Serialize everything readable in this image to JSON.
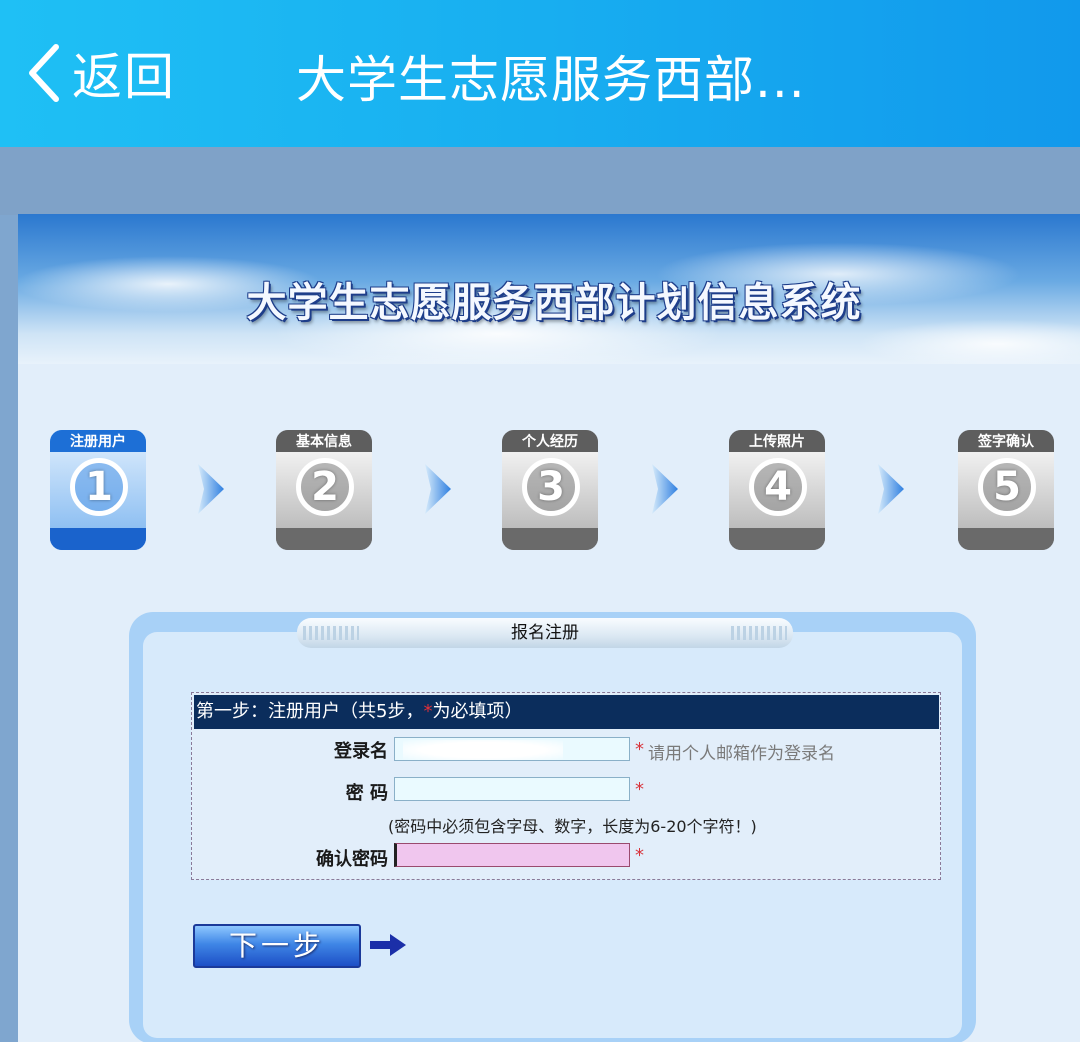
{
  "appbar": {
    "back_label": "返回",
    "title": "大学生志愿服务西部..."
  },
  "banner": {
    "title": "大学生志愿服务西部计划信息系统"
  },
  "steps": [
    {
      "label": "注册用户",
      "number": "1",
      "state": "active"
    },
    {
      "label": "基本信息",
      "number": "2",
      "state": "inactive"
    },
    {
      "label": "个人经历",
      "number": "3",
      "state": "inactive"
    },
    {
      "label": "上传照片",
      "number": "4",
      "state": "inactive"
    },
    {
      "label": "签字确认",
      "number": "5",
      "state": "inactive"
    }
  ],
  "form": {
    "panel_title": "报名注册",
    "step_heading_prefix": "第一步：注册用户（共5步，",
    "step_heading_star": "*",
    "step_heading_suffix": "为必填项）",
    "login": {
      "label": "登录名",
      "value": "",
      "required_mark": "*",
      "hint": "请用个人邮箱作为登录名"
    },
    "password": {
      "label": "密  码",
      "value": "",
      "required_mark": "*",
      "note": "(密码中必须包含字母、数字，长度为6-20个字符！)"
    },
    "confirm": {
      "label": "确认密码",
      "value": "",
      "required_mark": "*"
    },
    "next_button": "下一步"
  },
  "colors": {
    "appbar": "#18aef0",
    "active_step": "#1f6fd8",
    "inactive_step": "#6e6e6e",
    "form_header": "#0b2d5c",
    "required": "#e0303a",
    "confirm_field": "#f0c6ee"
  }
}
